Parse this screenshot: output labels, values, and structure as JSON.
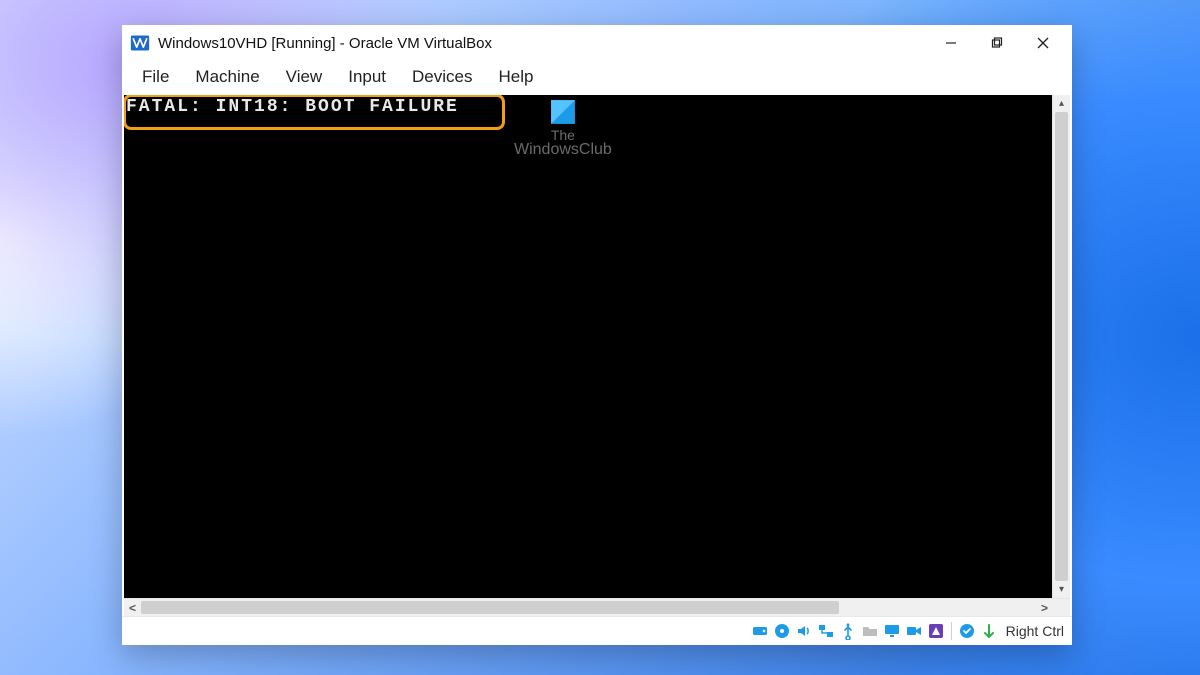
{
  "window": {
    "title": "Windows10VHD [Running] - Oracle VM VirtualBox"
  },
  "menubar": {
    "items": [
      "File",
      "Machine",
      "View",
      "Input",
      "Devices",
      "Help"
    ]
  },
  "vm": {
    "error_text": "FATAL: INT18: BOOT FAILURE"
  },
  "watermark": {
    "line1": "The",
    "line2": "WindowsClub"
  },
  "statusbar": {
    "hostkey_label": "Right Ctrl",
    "icons": [
      "hard-disk-icon",
      "optical-disk-icon",
      "audio-icon",
      "network-icon",
      "usb-icon",
      "shared-folder-icon",
      "display-icon",
      "recording-icon",
      "video-capture-icon",
      "cpu-icon",
      "mouse-integration-icon"
    ]
  },
  "colors": {
    "highlight_border": "#f2a012",
    "icon_blue": "#1e9be8",
    "icon_purple": "#6a3fb5",
    "icon_green": "#29b24a"
  }
}
